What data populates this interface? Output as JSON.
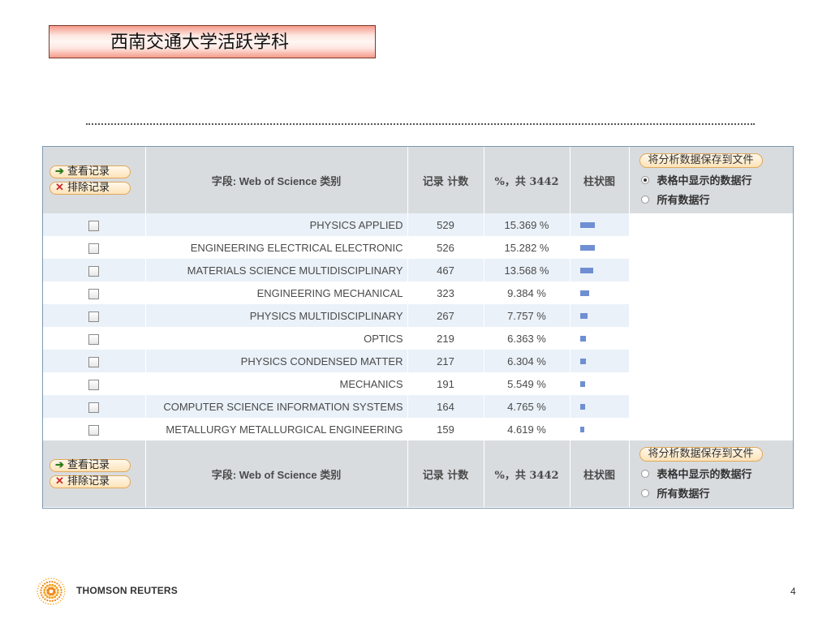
{
  "slide": {
    "title": "西南交通大学活跃学科",
    "page_number": "4"
  },
  "header": {
    "view_records": "查看记录",
    "exclude_records": "排除记录",
    "field_label": "字段: Web of Science 类别",
    "record_count": "记录 计数",
    "percent_total": "%，共 3442",
    "bar_chart": "柱状图",
    "save_button": "将分析数据保存到文件",
    "option_rows": "表格中显示的数据行",
    "option_all": "所有数据行"
  },
  "rows": [
    {
      "category": "PHYSICS APPLIED",
      "count": "529",
      "percent": "15.369 %",
      "bar_frac": 0.15369
    },
    {
      "category": "ENGINEERING ELECTRICAL ELECTRONIC",
      "count": "526",
      "percent": "15.282 %",
      "bar_frac": 0.15282
    },
    {
      "category": "MATERIALS SCIENCE MULTIDISCIPLINARY",
      "count": "467",
      "percent": "13.568 %",
      "bar_frac": 0.13568
    },
    {
      "category": "ENGINEERING MECHANICAL",
      "count": "323",
      "percent": "9.384 %",
      "bar_frac": 0.09384
    },
    {
      "category": "PHYSICS MULTIDISCIPLINARY",
      "count": "267",
      "percent": "7.757 %",
      "bar_frac": 0.07757
    },
    {
      "category": "OPTICS",
      "count": "219",
      "percent": "6.363 %",
      "bar_frac": 0.06363
    },
    {
      "category": "PHYSICS CONDENSED MATTER",
      "count": "217",
      "percent": "6.304 %",
      "bar_frac": 0.06304
    },
    {
      "category": "MECHANICS",
      "count": "191",
      "percent": "5.549 %",
      "bar_frac": 0.05549
    },
    {
      "category": "COMPUTER SCIENCE INFORMATION SYSTEMS",
      "count": "164",
      "percent": "4.765 %",
      "bar_frac": 0.04765
    },
    {
      "category": "METALLURGY METALLURGICAL ENGINEERING",
      "count": "159",
      "percent": "4.619 %",
      "bar_frac": 0.04619
    }
  ],
  "footer": {
    "brand": "THOMSON REUTERS"
  },
  "colors": {
    "bar": "#6f8fd2",
    "row_alt": "#eaf1f8",
    "header_bg": "#d9dcdf",
    "title_border": "#7a3a2a"
  },
  "icons": {
    "view": "arrow-right-icon",
    "exclude": "x-icon",
    "logo": "thomson-reuters-logo-icon"
  }
}
